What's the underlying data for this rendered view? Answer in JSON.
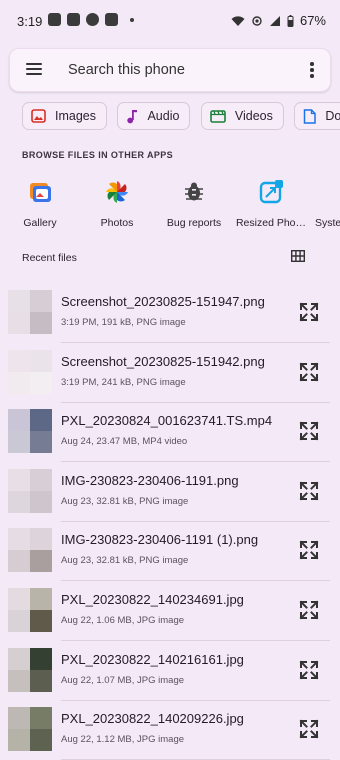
{
  "status": {
    "time": "3:19",
    "battery": "67%"
  },
  "search": {
    "placeholder": "Search this phone"
  },
  "chips": [
    {
      "label": "Images",
      "icon": "image-icon",
      "color": "#d93025"
    },
    {
      "label": "Audio",
      "icon": "music-note-icon",
      "color": "#8e24aa"
    },
    {
      "label": "Videos",
      "icon": "video-icon",
      "color": "#188038"
    },
    {
      "label": "Documents",
      "icon": "document-icon",
      "color": "#1a73e8"
    }
  ],
  "browse_title": "BROWSE FILES IN OTHER APPS",
  "apps": [
    {
      "label": "Gallery",
      "icon": "gallery-icon"
    },
    {
      "label": "Photos",
      "icon": "photos-pinwheel-icon"
    },
    {
      "label": "Bug reports",
      "icon": "bug-icon"
    },
    {
      "label": "Resized Pho…",
      "icon": "resize-icon"
    },
    {
      "label": "System",
      "icon": "system-icon"
    }
  ],
  "recent_title": "Recent files",
  "files": [
    {
      "name": "Screenshot_20230825-151947.png",
      "meta": "3:19 PM, 191 kB, PNG image",
      "colors": [
        "#e7e0e6",
        "#d7cdd5",
        "#e8dfe6",
        "#c6bcc4"
      ]
    },
    {
      "name": "Screenshot_20230825-151942.png",
      "meta": "3:19 PM, 241 kB, PNG image",
      "colors": [
        "#ede4ec",
        "#ebe3ea",
        "#f1ebf0",
        "#f3eef2"
      ]
    },
    {
      "name": "PXL_20230824_001623741.TS.mp4",
      "meta": "Aug 24, 23.47 MB, MP4 video",
      "colors": [
        "#c9c5d6",
        "#5c6886",
        "#cbc8d6",
        "#757c93"
      ]
    },
    {
      "name": "IMG-230823-230406-1191.png",
      "meta": "Aug 23, 32.81 kB, PNG image",
      "colors": [
        "#e8dee6",
        "#d8cfd6",
        "#ded6dd",
        "#cfc6cd"
      ]
    },
    {
      "name": "IMG-230823-230406-1191 (1).png",
      "meta": "Aug 23, 32.81 kB, PNG image",
      "colors": [
        "#e6dde4",
        "#ddd3db",
        "#d6cdd3",
        "#a99f9f"
      ]
    },
    {
      "name": "PXL_20230822_140234691.jpg",
      "meta": "Aug 22, 1.06 MB, JPG image",
      "colors": [
        "#e4dbe1",
        "#b9b4aa",
        "#d9d2d7",
        "#5f5a4a"
      ]
    },
    {
      "name": "PXL_20230822_140216161.jpg",
      "meta": "Aug 22, 1.07 MB, JPG image",
      "colors": [
        "#d6cfd2",
        "#344032",
        "#c5bfbd",
        "#5c5f4f"
      ]
    },
    {
      "name": "PXL_20230822_140209226.jpg",
      "meta": "Aug 22, 1.12 MB, JPG image",
      "colors": [
        "#bdb8b3",
        "#777c66",
        "#b5b3a8",
        "#5d6350"
      ]
    }
  ]
}
